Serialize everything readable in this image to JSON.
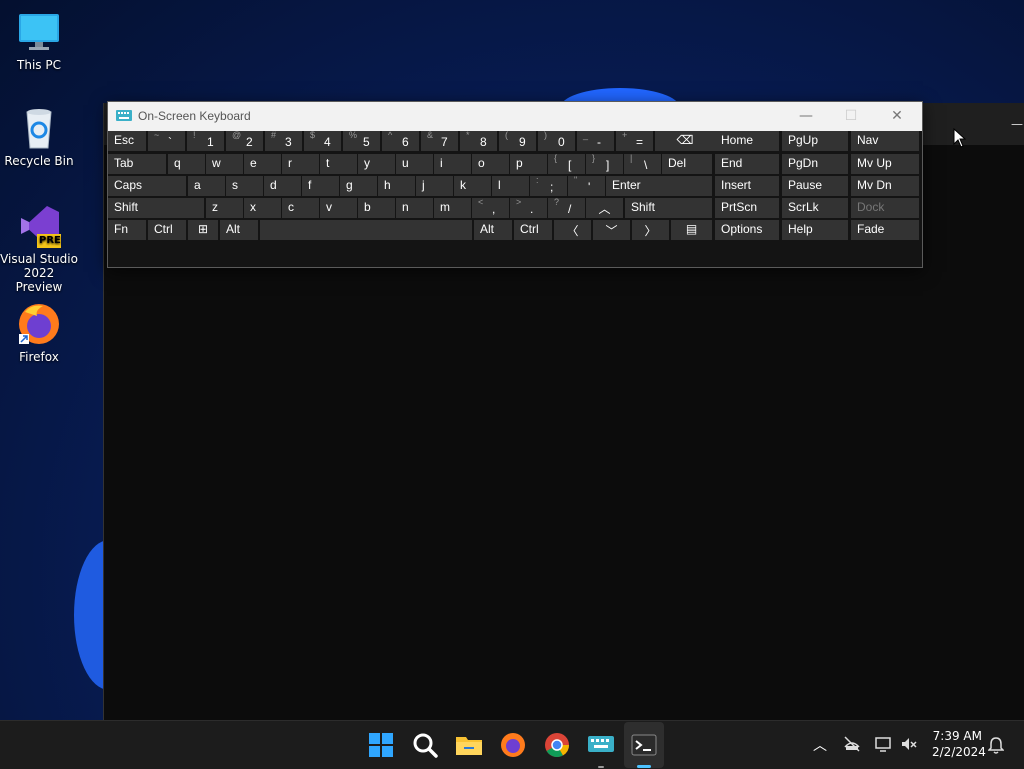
{
  "desktop": {
    "icons": [
      {
        "label": "This PC"
      },
      {
        "label": "Recycle Bin"
      },
      {
        "label": "Visual Studio 2022 Preview",
        "badge": "PRE"
      },
      {
        "label": "Firefox"
      }
    ]
  },
  "osk": {
    "title": "On-Screen Keyboard",
    "row1": [
      {
        "label": "Esc"
      },
      {
        "sub": "~",
        "main": "`"
      },
      {
        "sub": "!",
        "main": "1"
      },
      {
        "sub": "@",
        "main": "2"
      },
      {
        "sub": "#",
        "main": "3"
      },
      {
        "sub": "$",
        "main": "4"
      },
      {
        "sub": "%",
        "main": "5"
      },
      {
        "sub": "^",
        "main": "6"
      },
      {
        "sub": "&",
        "main": "7"
      },
      {
        "sub": "*",
        "main": "8"
      },
      {
        "sub": "(",
        "main": "9"
      },
      {
        "sub": ")",
        "main": "0"
      },
      {
        "sub": "_",
        "main": "-"
      },
      {
        "sub": "+",
        "main": "="
      }
    ],
    "row2": [
      {
        "label": "Tab"
      },
      {
        "label": "q"
      },
      {
        "label": "w"
      },
      {
        "label": "e"
      },
      {
        "label": "r"
      },
      {
        "label": "t"
      },
      {
        "label": "y"
      },
      {
        "label": "u"
      },
      {
        "label": "i"
      },
      {
        "label": "o"
      },
      {
        "label": "p"
      },
      {
        "sub": "{",
        "main": "["
      },
      {
        "sub": "}",
        "main": "]"
      },
      {
        "sub": "|",
        "main": "\\"
      },
      {
        "label": "Del"
      }
    ],
    "row3": [
      {
        "label": "Caps"
      },
      {
        "label": "a"
      },
      {
        "label": "s"
      },
      {
        "label": "d"
      },
      {
        "label": "f"
      },
      {
        "label": "g"
      },
      {
        "label": "h"
      },
      {
        "label": "j"
      },
      {
        "label": "k"
      },
      {
        "label": "l"
      },
      {
        "sub": ":",
        "main": ";"
      },
      {
        "sub": "\"",
        "main": "'"
      },
      {
        "label": "Enter"
      }
    ],
    "row4": [
      {
        "label": "Shift"
      },
      {
        "label": "z"
      },
      {
        "label": "x"
      },
      {
        "label": "c"
      },
      {
        "label": "v"
      },
      {
        "label": "b"
      },
      {
        "label": "n"
      },
      {
        "label": "m"
      },
      {
        "sub": "<",
        "main": ","
      },
      {
        "sub": ">",
        "main": "."
      },
      {
        "sub": "?",
        "main": "/"
      },
      {
        "label": "Shift"
      }
    ],
    "row5": [
      {
        "label": "Fn"
      },
      {
        "label": "Ctrl"
      },
      {
        "label": "Alt"
      },
      {
        "label": "Alt"
      },
      {
        "label": "Ctrl"
      }
    ],
    "nav": [
      [
        "Home",
        "PgUp",
        "Nav"
      ],
      [
        "End",
        "PgDn",
        "Mv Up"
      ],
      [
        "Insert",
        "Pause",
        "Mv Dn"
      ],
      [
        "PrtScn",
        "ScrLk",
        "Dock"
      ],
      [
        "Options",
        "Help",
        "Fade"
      ]
    ]
  },
  "taskbar": {
    "time": "7:39 AM",
    "date": "2/2/2024"
  },
  "colors": {
    "accent": "#4cc2ff",
    "key_bg": "#333333",
    "osk_bg": "#141414"
  }
}
